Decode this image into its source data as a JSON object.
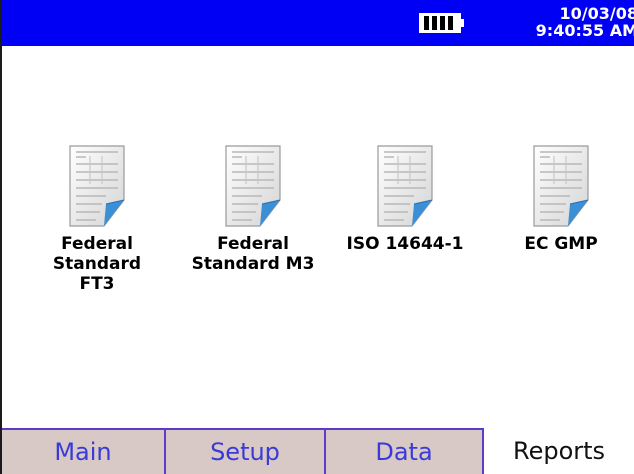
{
  "status_bar": {
    "date": "10/03/08",
    "time": "9:40:55 AM",
    "battery_icon": "battery-full-icon",
    "background_color": "#0000f4"
  },
  "reports": [
    {
      "label": "Federal\nStandard\nFT3",
      "icon": "report-document-icon"
    },
    {
      "label": "Federal\nStandard M3",
      "icon": "report-document-icon"
    },
    {
      "label": "ISO 14644-1",
      "icon": "report-document-icon"
    },
    {
      "label": "EC GMP",
      "icon": "report-document-icon"
    }
  ],
  "tabs": [
    {
      "label": "Main",
      "active": false
    },
    {
      "label": "Setup",
      "active": false
    },
    {
      "label": "Data",
      "active": false
    },
    {
      "label": "Reports",
      "active": true
    }
  ],
  "colors": {
    "tab_inactive_bg": "#d8c8c6",
    "tab_inactive_text": "#3a3ad8",
    "tab_border": "#5a3dc4",
    "page_fold": "#3a8fd6"
  }
}
